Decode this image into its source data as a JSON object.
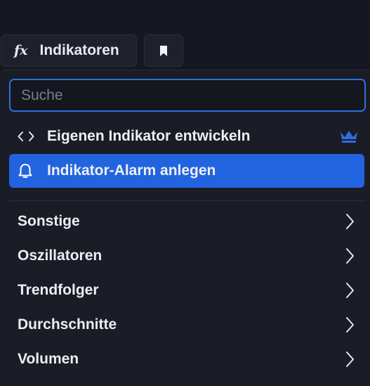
{
  "toolbar": {
    "fx_label": "fx",
    "indicators_label": "Indikatoren",
    "bookmark_icon": "bookmark-icon"
  },
  "search": {
    "placeholder": "Suche",
    "value": ""
  },
  "actions": [
    {
      "label": "Eigenen Indikator entwickeln",
      "icon": "code-brackets-icon",
      "badge_icon": "crown-icon"
    },
    {
      "label": "Indikator-Alarm anlegen",
      "icon": "bell-icon",
      "highlighted": true
    }
  ],
  "categories": [
    {
      "label": "Sonstige"
    },
    {
      "label": "Oszillatoren"
    },
    {
      "label": "Trendfolger"
    },
    {
      "label": "Durchschnitte"
    },
    {
      "label": "Volumen"
    }
  ],
  "colors": {
    "background": "#151821",
    "panel": "#1a1d25",
    "accent": "#2264e0",
    "search_border": "#2f6ee0",
    "crown": "#2f6ee0",
    "text": "#eceef3"
  }
}
